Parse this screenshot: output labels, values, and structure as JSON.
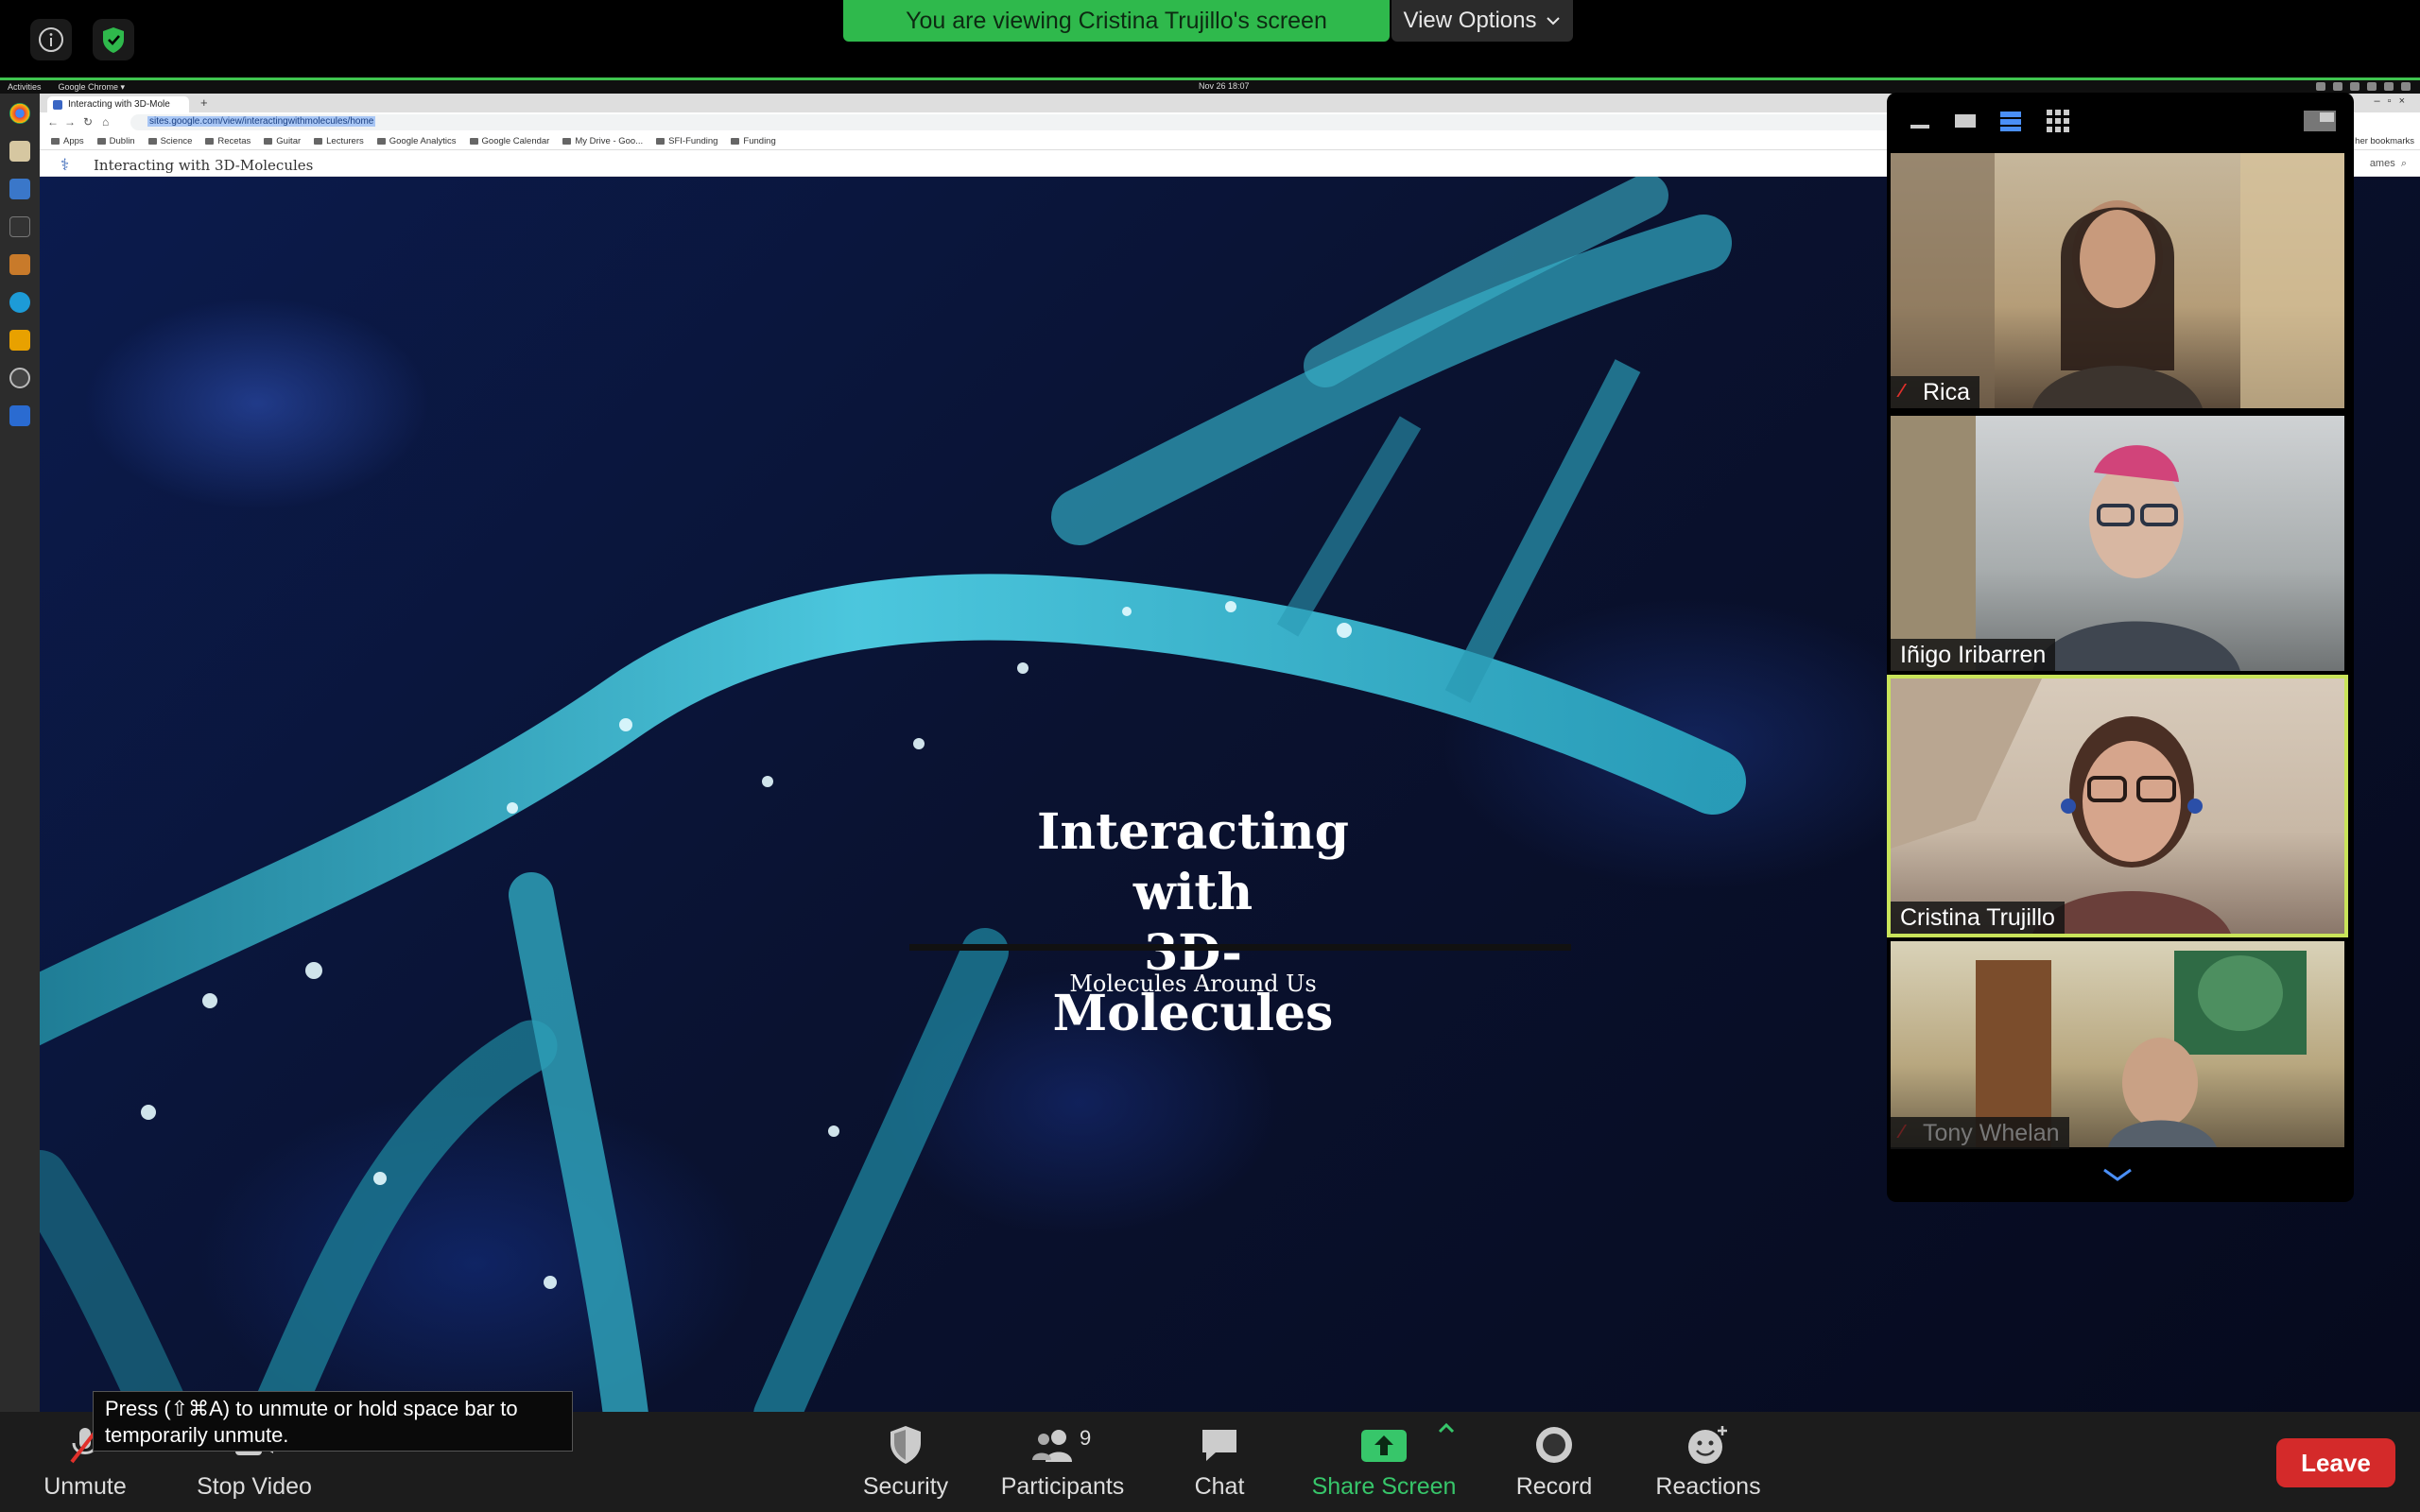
{
  "top_bar": {
    "viewing_banner": "You are viewing Cristina Trujillo's screen",
    "view_options_label": "View Options",
    "info_icon": "info-icon",
    "security_shield_icon": "shield-check-icon",
    "banner_color": "#2fb94c"
  },
  "ubuntu": {
    "activities": "Activities",
    "app_menu": "Google Chrome ▾",
    "clock": "Nov 26  18:07"
  },
  "browser": {
    "tab_title": "Interacting with 3D-Mole",
    "url": "sites.google.com/view/interactingwithmolecules/home",
    "bookmarks": [
      "Apps",
      "Dublin",
      "Science",
      "Recetas",
      "Guitar",
      "Lecturers",
      "Google Analytics",
      "Google Calendar",
      "My Drive - Goo...",
      "SFI-Funding",
      "Funding"
    ],
    "other_bookmarks": "her bookmarks"
  },
  "site": {
    "name": "Interacting with 3D-Molecules",
    "right_label": "ames",
    "hero_title_line1": "Interacting with",
    "hero_title_line2": "3D-Molecules",
    "hero_subtitle": "Molecules Around Us"
  },
  "gallery": {
    "participants": [
      {
        "name": "Rica",
        "muted": true,
        "active": false
      },
      {
        "name": "Iñigo Iribarren",
        "muted": false,
        "active": false
      },
      {
        "name": "Cristina Trujillo",
        "muted": false,
        "active": true
      },
      {
        "name": "Tony Whelan",
        "muted": true,
        "active": false
      }
    ],
    "active_speaker_color": "#c9e45a"
  },
  "toolbar": {
    "unmute": "Unmute",
    "stop_video": "Stop Video",
    "security": "Security",
    "participants": "Participants",
    "participants_count": "9",
    "chat": "Chat",
    "share_screen": "Share Screen",
    "record": "Record",
    "reactions": "Reactions",
    "leave": "Leave",
    "share_color": "#37c66a",
    "leave_color": "#d42a2a"
  },
  "tooltip": {
    "unmute_hint": "Press  (⇧⌘A) to unmute or hold space bar to temporarily unmute."
  }
}
